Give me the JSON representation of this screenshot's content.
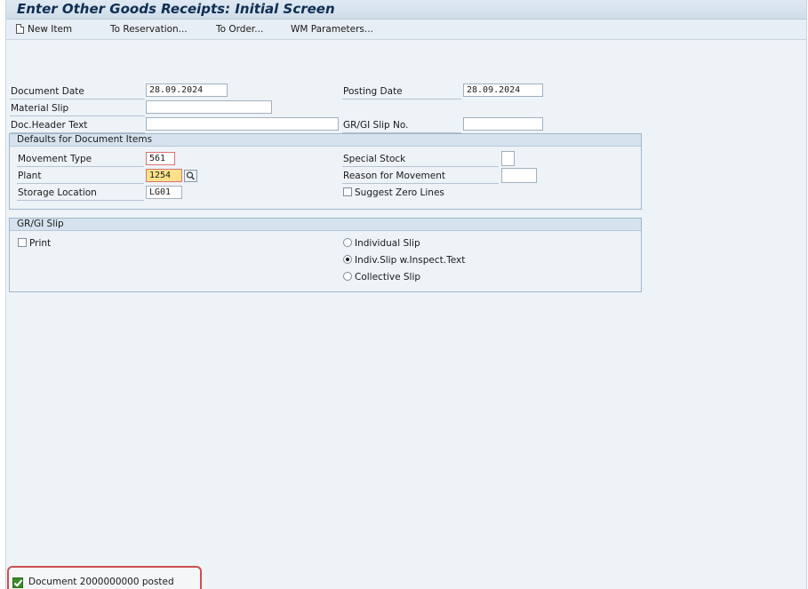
{
  "window": {
    "title": "Enter Other Goods Receipts: Initial Screen"
  },
  "toolbar": {
    "new_item": "New Item",
    "to_reservation": "To Reservation...",
    "to_order": "To Order...",
    "wm_parameters": "WM Parameters..."
  },
  "header": {
    "document_date_label": "Document Date",
    "document_date": "28.09.2024",
    "posting_date_label": "Posting Date",
    "posting_date": "28.09.2024",
    "material_slip_label": "Material Slip",
    "material_slip": "",
    "doc_header_text_label": "Doc.Header Text",
    "doc_header_text": "",
    "gr_gi_slip_no_label": "GR/GI Slip No.",
    "gr_gi_slip_no": ""
  },
  "defaults": {
    "title": "Defaults for Document Items",
    "movement_type_label": "Movement Type",
    "movement_type": "561",
    "plant_label": "Plant",
    "plant": "1254",
    "storage_location_label": "Storage Location",
    "storage_location": "LG01",
    "special_stock_label": "Special Stock",
    "special_stock": "",
    "reason_for_movement_label": "Reason for Movement",
    "reason_for_movement": "",
    "suggest_zero_lines_label": "Suggest Zero Lines",
    "suggest_zero_lines": false
  },
  "slip": {
    "title": "GR/GI Slip",
    "print_label": "Print",
    "print": false,
    "options": [
      "Individual Slip",
      "Indiv.Slip w.Inspect.Text",
      "Collective Slip"
    ],
    "selected": "Indiv.Slip w.Inspect.Text"
  },
  "status": {
    "type": "success",
    "message": "Document 2000000000 posted"
  },
  "colors": {
    "background": "#eef3f8",
    "title_text": "#0f2e52",
    "required_border": "#d97373",
    "highlight_field": "#fbe28a",
    "status_frame": "#c9504f",
    "success_icon": "#3d8b2a"
  }
}
